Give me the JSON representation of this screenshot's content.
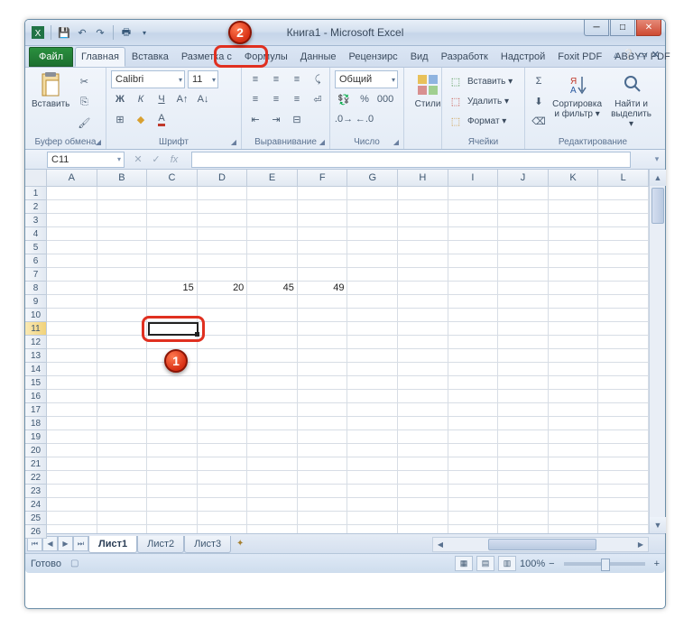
{
  "title": "Книга1 - Microsoft Excel",
  "tabs": {
    "file": "Файл",
    "home": "Главная",
    "insert": "Вставка",
    "layout": "Разметка с",
    "formulas": "Формулы",
    "data": "Данные",
    "review": "Рецензирс",
    "view": "Вид",
    "dev": "Разработк",
    "addins": "Надстрой",
    "foxit": "Foxit PDF",
    "abbyy": "ABBYY PDF"
  },
  "groups": {
    "clipboard": {
      "paste": "Вставить",
      "label": "Буфер обмена"
    },
    "font": {
      "name": "Calibri",
      "size": "11",
      "label": "Шрифт"
    },
    "align": {
      "label": "Выравнивание"
    },
    "number": {
      "format": "Общий",
      "label": "Число"
    },
    "styles": {
      "styles": "Стили"
    },
    "cells": {
      "insert": "Вставить ▾",
      "delete": "Удалить ▾",
      "format": "Формат ▾",
      "label": "Ячейки"
    },
    "editing": {
      "sort": "Сортировка\nи фильтр ▾",
      "find": "Найти и\nвыделить ▾",
      "label": "Редактирование"
    }
  },
  "namebox": "C11",
  "columns": [
    "A",
    "B",
    "C",
    "D",
    "E",
    "F",
    "G",
    "H",
    "I",
    "J",
    "K",
    "L"
  ],
  "rows": [
    "1",
    "2",
    "3",
    "4",
    "5",
    "6",
    "7",
    "8",
    "9",
    "10",
    "11",
    "12",
    "13",
    "14",
    "15",
    "16",
    "17",
    "18",
    "19",
    "20",
    "21",
    "22",
    "23",
    "24",
    "25",
    "26"
  ],
  "active_row": "11",
  "cell_data": {
    "r": 8,
    "vals": {
      "C": "15",
      "D": "20",
      "E": "45",
      "F": "49"
    }
  },
  "sheets": {
    "s1": "Лист1",
    "s2": "Лист2",
    "s3": "Лист3"
  },
  "status": {
    "ready": "Готово",
    "zoom": "100%"
  },
  "callouts": {
    "c1": "1",
    "c2": "2"
  },
  "zoom_ctrl": {
    "minus": "−",
    "plus": "+"
  }
}
